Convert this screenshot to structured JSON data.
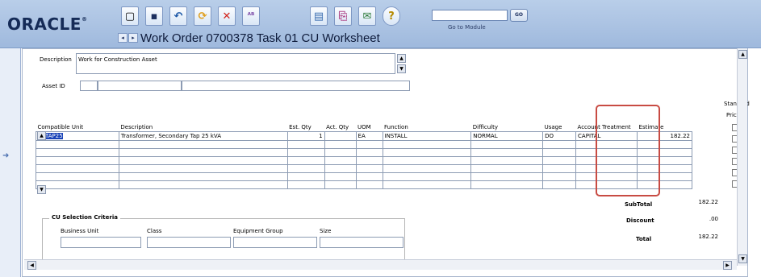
{
  "header": {
    "logo": "ORACLE",
    "title": "Work Order 0700378 Task 01 CU Worksheet",
    "goto_label": "Go to Module",
    "go_button": "GO",
    "nav_prev": "◂",
    "nav_next": "▸"
  },
  "toolbar": [
    {
      "name": "new-icon",
      "glyph": "▢"
    },
    {
      "name": "save-icon",
      "glyph": "▪"
    },
    {
      "name": "undo-icon",
      "glyph": "↶"
    },
    {
      "name": "refresh-icon",
      "glyph": "⟳"
    },
    {
      "name": "delete-icon",
      "glyph": "✕"
    },
    {
      "name": "spellcheck-icon",
      "glyph": "ᴬᴮ"
    },
    {
      "name": "report-icon",
      "glyph": "▤"
    },
    {
      "name": "attach-icon",
      "glyph": "⎘"
    },
    {
      "name": "mail-icon",
      "glyph": "✉"
    },
    {
      "name": "help-icon",
      "glyph": "?"
    }
  ],
  "form": {
    "description_label": "Description",
    "description_value": "Work for Construction Asset",
    "asset_id_label": "Asset ID"
  },
  "grid": {
    "columns": [
      "Compatible Unit",
      "Description",
      "Est. Qty",
      "Act. Qty",
      "UOM",
      "Function",
      "Difficulty",
      "Usage",
      "Account Treatment",
      "Estimate"
    ],
    "standard_price_label_1": "Standard",
    "standard_price_label_2": "Price",
    "rows": [
      [
        "KSTAP25",
        "Transformer, Secondary Tap 25 kVA",
        "1",
        "",
        "EA",
        "INSTALL",
        "NORMAL",
        "DO",
        "CAPITAL",
        "182.22"
      ],
      [
        "",
        "",
        "",
        "",
        "",
        "",
        "",
        "",
        "",
        ""
      ],
      [
        "",
        "",
        "",
        "",
        "",
        "",
        "",
        "",
        "",
        ""
      ],
      [
        "",
        "",
        "",
        "",
        "",
        "",
        "",
        "",
        "",
        ""
      ],
      [
        "",
        "",
        "",
        "",
        "",
        "",
        "",
        "",
        "",
        ""
      ],
      [
        "",
        "",
        "",
        "",
        "",
        "",
        "",
        "",
        "",
        ""
      ],
      [
        "",
        "",
        "",
        "",
        "",
        "",
        "",
        "",
        "",
        ""
      ]
    ]
  },
  "totals": {
    "subtotal_label": "SubTotal",
    "subtotal_value": "182.22",
    "discount_label": "Discount",
    "discount_value": ".00",
    "total_label": "Total",
    "total_value": "182.22"
  },
  "criteria": {
    "title": "CU Selection Criteria",
    "business_unit_label": "Business Unit",
    "class_label": "Class",
    "equipment_group_label": "Equipment Group",
    "size_label": "Size"
  },
  "colors": {
    "header_bg": "#a9c2e4",
    "highlight": "#c84b43",
    "selection": "#1a43b8"
  }
}
